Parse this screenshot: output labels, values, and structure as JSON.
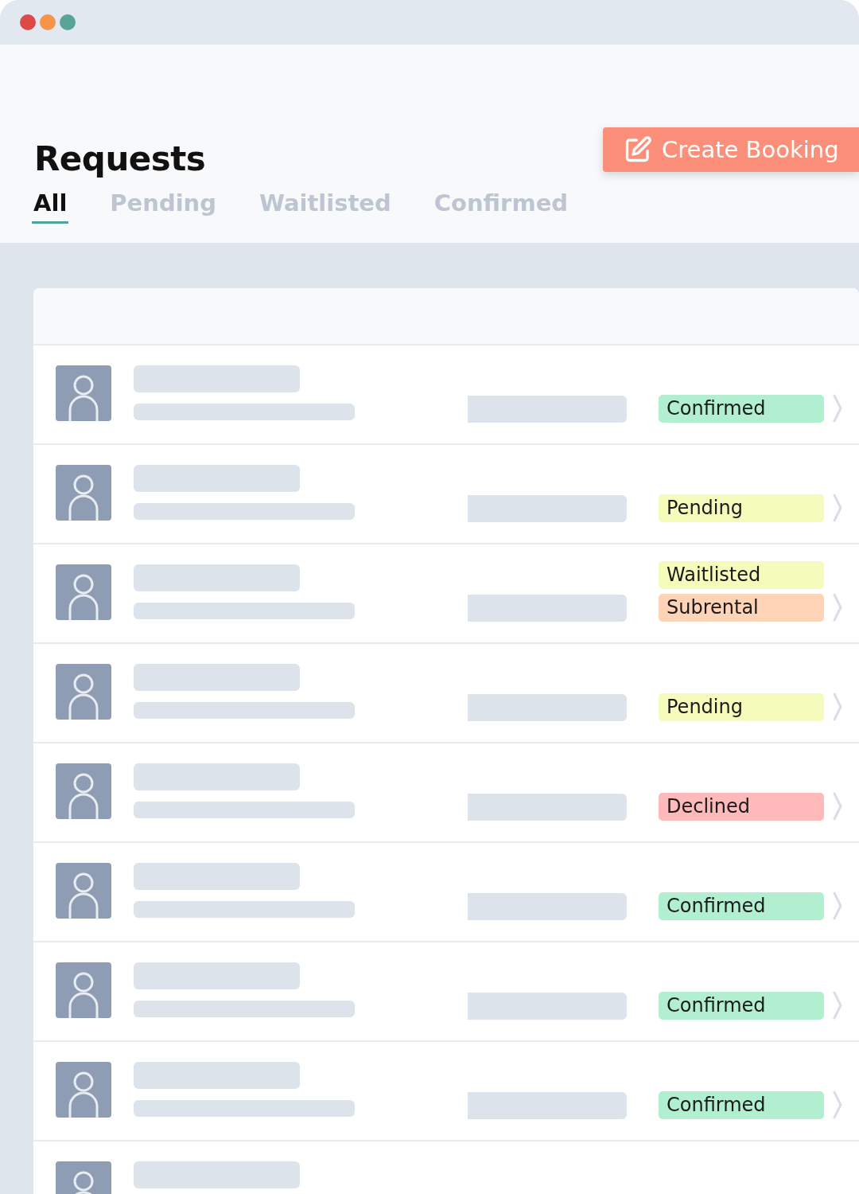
{
  "header": {
    "title": "Requests",
    "create_button": "Create Booking"
  },
  "tabs": [
    {
      "label": "All",
      "selected": true
    },
    {
      "label": "Pending",
      "selected": false
    },
    {
      "label": "Waitlisted",
      "selected": false
    },
    {
      "label": "Confirmed",
      "selected": false
    }
  ],
  "rows": [
    {
      "tags": [
        {
          "label": "Confirmed",
          "color": "#b2efd0"
        }
      ]
    },
    {
      "tags": [
        {
          "label": "Pending",
          "color": "#f5fbbb"
        }
      ]
    },
    {
      "tags": [
        {
          "label": "Waitlisted",
          "color": "#f5fbbb"
        },
        {
          "label": "Subrental",
          "color": "#fed3b6"
        }
      ]
    },
    {
      "tags": [
        {
          "label": "Pending",
          "color": "#f5fbbb"
        }
      ]
    },
    {
      "tags": [
        {
          "label": "Declined",
          "color": "#feb9bb"
        }
      ]
    },
    {
      "tags": [
        {
          "label": "Confirmed",
          "color": "#b2efd0"
        }
      ]
    },
    {
      "tags": [
        {
          "label": "Confirmed",
          "color": "#b2efd0"
        }
      ]
    },
    {
      "tags": [
        {
          "label": "Confirmed",
          "color": "#b2efd0"
        }
      ]
    },
    {
      "tags": []
    }
  ]
}
